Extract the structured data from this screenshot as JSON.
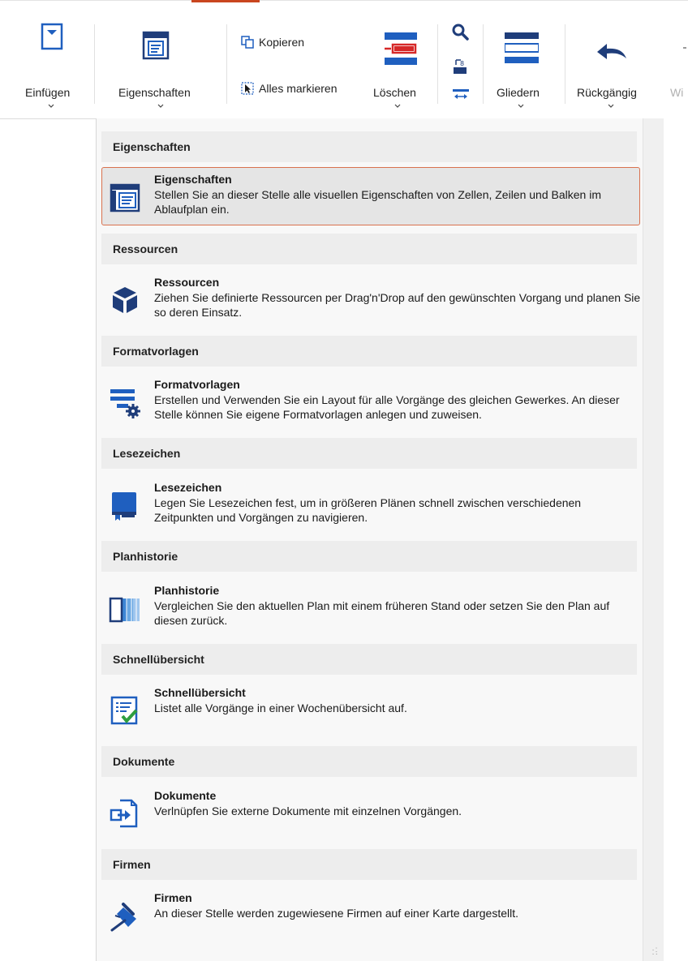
{
  "ribbon": {
    "insert_label": "Einfügen",
    "properties_label": "Eigenschaften",
    "copy_label": "Kopieren",
    "select_all_label": "Alles markieren",
    "delete_label": "Löschen",
    "outline_label": "Gliedern",
    "undo_label": "Rückgängig",
    "redo_label": "Wi"
  },
  "menu": {
    "sections": [
      {
        "header": "Eigenschaften",
        "title": "Eigenschaften",
        "desc": "Stellen Sie an dieser Stelle alle visuellen Eigenschaften von Zellen, Zeilen und Balken im Ablaufplan ein.",
        "icon": "properties-icon"
      },
      {
        "header": "Ressourcen",
        "title": "Ressourcen",
        "desc": "Ziehen Sie definierte Ressourcen per Drag'n'Drop auf den gewünschten Vorgang und planen Sie so deren Einsatz.",
        "icon": "cube-icon"
      },
      {
        "header": "Formatvorlagen",
        "title": "Formatvorlagen",
        "desc": "Erstellen und Verwenden Sie ein Layout für alle Vorgänge des gleichen Gewerkes. An dieser Stelle können Sie eigene Formatvorlagen anlegen und zuweisen.",
        "icon": "format-template-icon"
      },
      {
        "header": "Lesezeichen",
        "title": "Lesezeichen",
        "desc": "Legen Sie Lesezeichen fest, um in größeren Plänen schnell zwischen verschiedenen Zeitpunkten und Vorgängen zu navigieren.",
        "icon": "bookmark-icon"
      },
      {
        "header": "Planhistorie",
        "title": "Planhistorie",
        "desc": "Vergleichen Sie den aktuellen Plan mit einem früheren Stand oder setzen Sie den Plan auf diesen zurück.",
        "icon": "history-icon"
      },
      {
        "header": "Schnellübersicht",
        "title": "Schnellübersicht",
        "desc": "Listet alle Vorgänge in einer Wochenübersicht auf.",
        "icon": "checklist-icon"
      },
      {
        "header": "Dokumente",
        "title": "Dokumente",
        "desc": "Verlnüpfen Sie externe Dokumente mit einzelnen Vorgängen.",
        "icon": "document-link-icon"
      },
      {
        "header": "Firmen",
        "title": "Firmen",
        "desc": "An dieser Stelle werden zugewiesene Firmen auf einer Karte dargestellt.",
        "icon": "pin-icon"
      }
    ]
  },
  "colors": {
    "accent": "#c9461f",
    "icon_blue": "#0078d4",
    "dark_blue": "#1f3d7a",
    "highlight_border": "#d9714e"
  }
}
